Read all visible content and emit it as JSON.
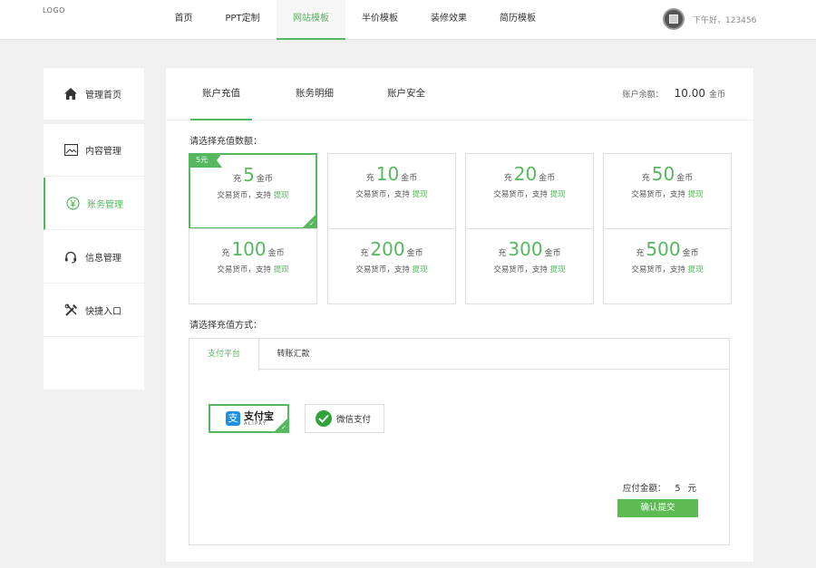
{
  "header": {
    "logo": "LOGO",
    "nav": [
      "首页",
      "PPT定制",
      "网站模板",
      "半价模板",
      "装修效果",
      "简历模板"
    ],
    "active_nav": "网站模板",
    "greeting": "下午好，123456"
  },
  "sidebar": {
    "items": [
      {
        "label": "管理首页",
        "icon": "home-icon"
      },
      {
        "label": "内容管理",
        "icon": "image-icon"
      },
      {
        "label": "账务管理",
        "icon": "yen-icon"
      },
      {
        "label": "信息管理",
        "icon": "headset-icon"
      },
      {
        "label": "快捷入口",
        "icon": "tools-icon"
      }
    ],
    "active": "账务管理"
  },
  "main": {
    "tabs": [
      "账户充值",
      "账务明细",
      "账户安全"
    ],
    "active_tab": "账户充值",
    "balance_label": "账户余额：",
    "balance_value": "10.00",
    "balance_unit": "金币",
    "amount_prompt": "请选择充值数额：",
    "selected_badge": "5元",
    "cards": [
      {
        "prefix": "充",
        "value": "5",
        "unit": "金币",
        "desc": "交易货币，支持",
        "link": "提现"
      },
      {
        "prefix": "充",
        "value": "10",
        "unit": "金币",
        "desc": "交易货币，支持",
        "link": "提现"
      },
      {
        "prefix": "充",
        "value": "20",
        "unit": "金币",
        "desc": "交易货币，支持",
        "link": "提现"
      },
      {
        "prefix": "充",
        "value": "50",
        "unit": "金币",
        "desc": "交易货币，支持",
        "link": "提现"
      },
      {
        "prefix": "充",
        "value": "100",
        "unit": "金币",
        "desc": "交易货币，支持",
        "link": "提现"
      },
      {
        "prefix": "充",
        "value": "200",
        "unit": "金币",
        "desc": "交易货币，支持",
        "link": "提现"
      },
      {
        "prefix": "充",
        "value": "300",
        "unit": "金币",
        "desc": "交易货币，支持",
        "link": "提现"
      },
      {
        "prefix": "充",
        "value": "500",
        "unit": "金币",
        "desc": "交易货币，支持",
        "link": "提现"
      }
    ],
    "method_prompt": "请选择充值方式：",
    "pay_tabs": [
      "支付平台",
      "转账汇款"
    ],
    "active_pay_tab": "支付平台",
    "alipay": {
      "cn": "支付宝",
      "en": "ALIPAY",
      "glyph": "支"
    },
    "wechat": {
      "label": "微信支付"
    },
    "due_label": "应付金额：",
    "due_value": "5",
    "due_unit": "元",
    "submit_label": "确认提交"
  },
  "colors": {
    "accent": "#55b85e",
    "alipay_blue": "#1f8fe6",
    "wechat_green": "#2fa23a"
  }
}
